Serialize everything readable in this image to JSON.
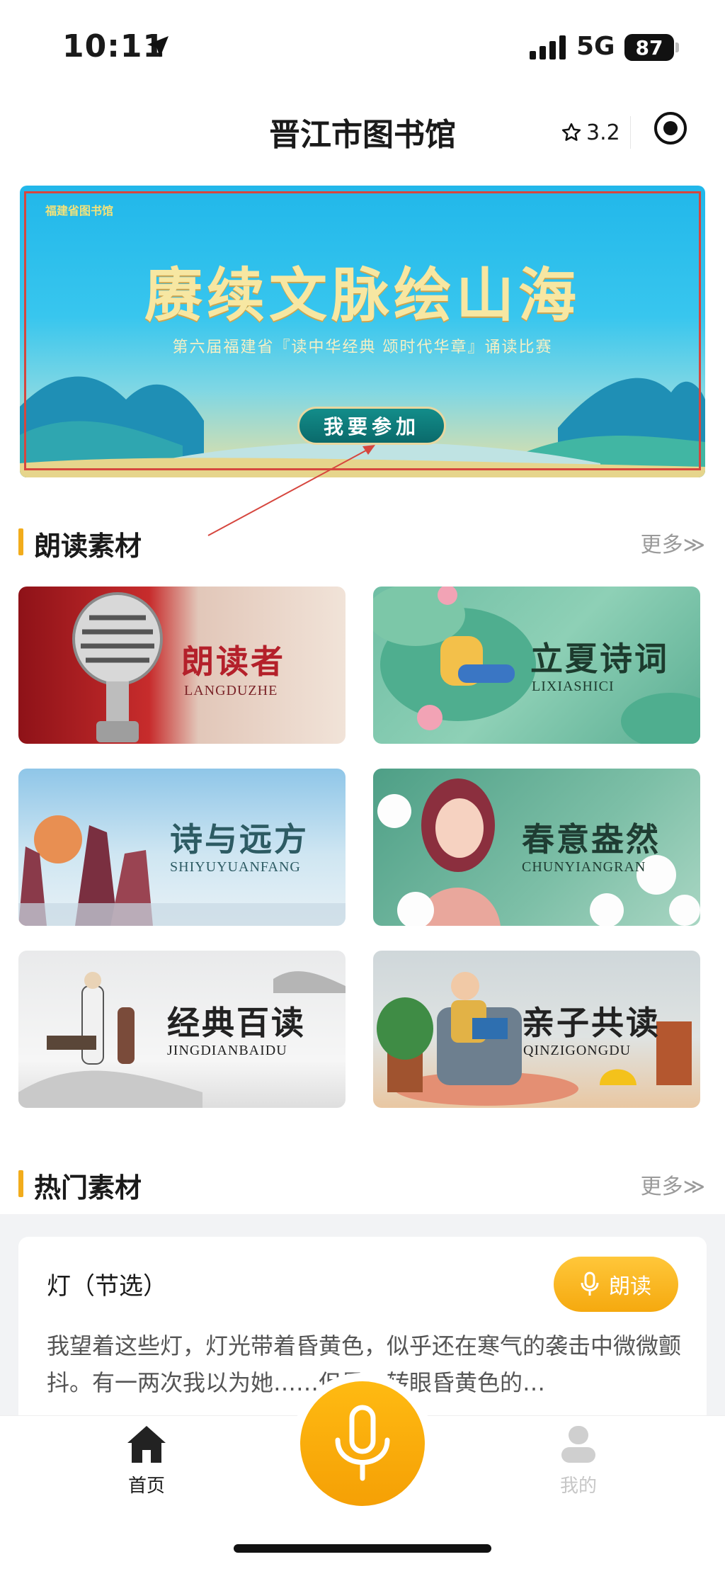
{
  "status_bar": {
    "time": "10:11",
    "network": "5G",
    "battery": "87"
  },
  "navbar": {
    "title": "晋江市图书馆",
    "rating": "3.2"
  },
  "banner": {
    "badge": "福建省图书馆",
    "headline": "赓续文脉绘山海",
    "subtitle": "第六届福建省『读中华经典 颂时代华章』诵读比赛",
    "join_label": "我要参加"
  },
  "materials": {
    "heading": "朗读素材",
    "more": "更多≫",
    "items": [
      {
        "title": "朗读者",
        "pinyin": "LANGDUZHE"
      },
      {
        "title": "立夏诗词",
        "pinyin": "LIXIASHICI"
      },
      {
        "title": "诗与远方",
        "pinyin": "SHIYUYUANFANG"
      },
      {
        "title": "春意盎然",
        "pinyin": "CHUNYIANGRAN"
      },
      {
        "title": "经典百读",
        "pinyin": "JINGDIANBAIDU"
      },
      {
        "title": "亲子共读",
        "pinyin": "QINZIGONGDU"
      }
    ]
  },
  "hot": {
    "heading": "热门素材",
    "more": "更多≫",
    "item": {
      "title": "灯（节选）",
      "read_label": "朗读",
      "excerpt": "我望着这些灯，灯光带着昏黄色，似乎还在寒气的袭击中微微颤抖。有一两次我以为她……但是一转眼昏黄色的…"
    }
  },
  "tabbar": {
    "home": "首页",
    "mine": "我的"
  },
  "colors": {
    "accent": "#f5a90f",
    "section_bar": "#f2ac1c",
    "banner_frame": "#d6463e"
  }
}
